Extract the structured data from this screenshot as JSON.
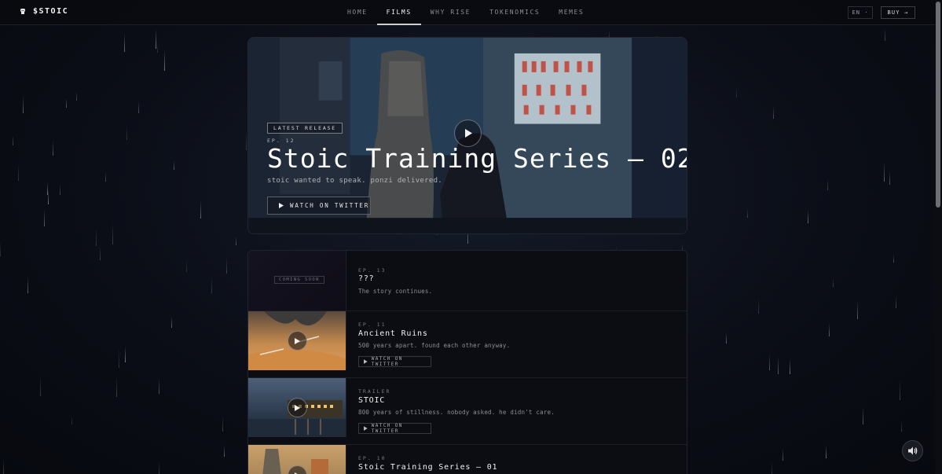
{
  "header": {
    "logo": "$STOIC",
    "nav": [
      {
        "label": "HOME",
        "active": false
      },
      {
        "label": "FILMS",
        "active": true
      },
      {
        "label": "WHY RISE",
        "active": false
      },
      {
        "label": "TOKENOMICS",
        "active": false
      },
      {
        "label": "MEMES",
        "active": false
      }
    ],
    "lang": "EN ·",
    "buy": "BUY →"
  },
  "hero": {
    "badge": "LATEST RELEASE",
    "episode": "EP. 12",
    "title": "Stoic Training Series — 02",
    "subtitle": "stoic wanted to speak. ponzi delivered.",
    "button": "WATCH ON TWITTER"
  },
  "episodes": [
    {
      "ep": "EP. 13",
      "title": "???",
      "desc": "The story continues.",
      "badge": "COMING SOON"
    },
    {
      "ep": "EP. 11",
      "title": "Ancient Ruins",
      "desc": "500 years apart. found each other anyway.",
      "button": "WATCH ON TWITTER"
    },
    {
      "ep": "TRAILER",
      "title": "STOIC",
      "desc": "800 years of stillness. nobody asked. he didn't care.",
      "button": "WATCH ON TWITTER"
    },
    {
      "ep": "EP. 10",
      "title": "Stoic Training Series — 01"
    }
  ],
  "colors": {
    "background": "#0b0e17",
    "accent": "#f5f5f5",
    "muted": "#8a8d96"
  },
  "icons": [
    "logo-icon",
    "play-icon",
    "sound-icon"
  ]
}
